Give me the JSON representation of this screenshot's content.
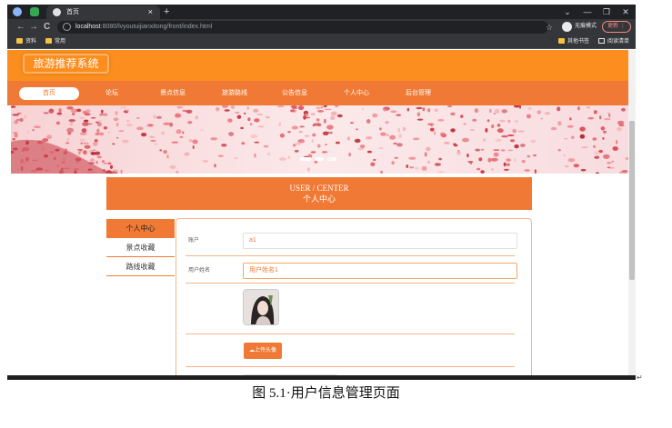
{
  "browser": {
    "tab_title": "首页",
    "tab_close": "×",
    "new_tab": "+",
    "back": "←",
    "forward": "→",
    "reload": "C",
    "url_host": "localhost",
    "url_path": ":8080/lvyoutuijianxitong/front/index.html",
    "star": "☆",
    "incognito_label": "无痕模式",
    "update_label": "更新 ⋮",
    "window_controls": [
      "⌄",
      "—",
      "❐",
      "✕"
    ],
    "bookmarks": [
      "资料",
      "常用"
    ],
    "bookmarks_right": [
      "其他书签",
      "阅读清单"
    ]
  },
  "site": {
    "logo": "旅游推荐系统"
  },
  "menu": [
    {
      "label": "首页",
      "active": true
    },
    {
      "label": "论坛",
      "active": false
    },
    {
      "label": "景点信息",
      "active": false
    },
    {
      "label": "旅游路线",
      "active": false
    },
    {
      "label": "公告信息",
      "active": false
    },
    {
      "label": "个人中心",
      "active": false
    },
    {
      "label": "后台管理",
      "active": false
    }
  ],
  "center": {
    "title_en": "USER / CENTER",
    "title_cn": "个人中心"
  },
  "sidebar": [
    {
      "label": "个人中心",
      "active": true
    },
    {
      "label": "景点收藏",
      "active": false
    },
    {
      "label": "路线收藏",
      "active": false
    }
  ],
  "form": {
    "account_label": "账户",
    "account_value": "a1",
    "name_label": "用户姓名",
    "name_value": "用户姓名1",
    "upload_label": "上传头像"
  },
  "figure_caption": "图 5.1·用户信息管理页面",
  "colors": {
    "header": "#fb8e1e",
    "menubar": "#f07a35",
    "accent": "#f07a35"
  }
}
